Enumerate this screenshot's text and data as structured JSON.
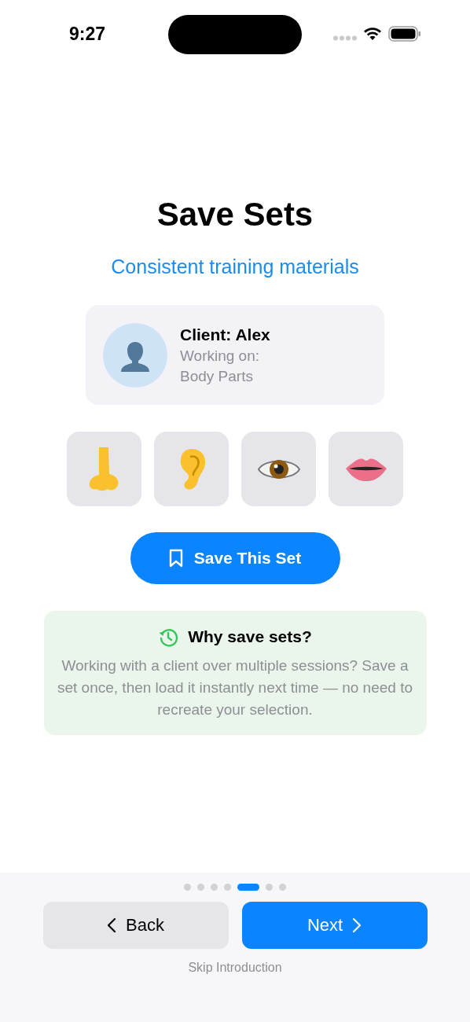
{
  "status_bar": {
    "time": "9:27"
  },
  "title": "Save Sets",
  "subtitle": "Consistent training materials",
  "client_card": {
    "name": "Client: Alex",
    "label": "Working on:",
    "topic": "Body Parts"
  },
  "tiles": [
    {
      "kind": "nose"
    },
    {
      "kind": "ear"
    },
    {
      "kind": "eye"
    },
    {
      "kind": "lips"
    }
  ],
  "save_button": {
    "label": "Save This Set"
  },
  "info": {
    "title": "Why save sets?",
    "body": "Working with a client over multiple sessions? Save a set once, then load it instantly next time — no need to recreate your selection."
  },
  "page_dots": [
    {
      "selected": false
    },
    {
      "selected": false
    },
    {
      "selected": false
    },
    {
      "selected": false
    },
    {
      "selected": true
    },
    {
      "selected": false
    },
    {
      "selected": false
    }
  ],
  "back_button": {
    "label": "Back"
  },
  "next_button": {
    "label": "Next"
  },
  "skip_link": "Skip Introduction"
}
